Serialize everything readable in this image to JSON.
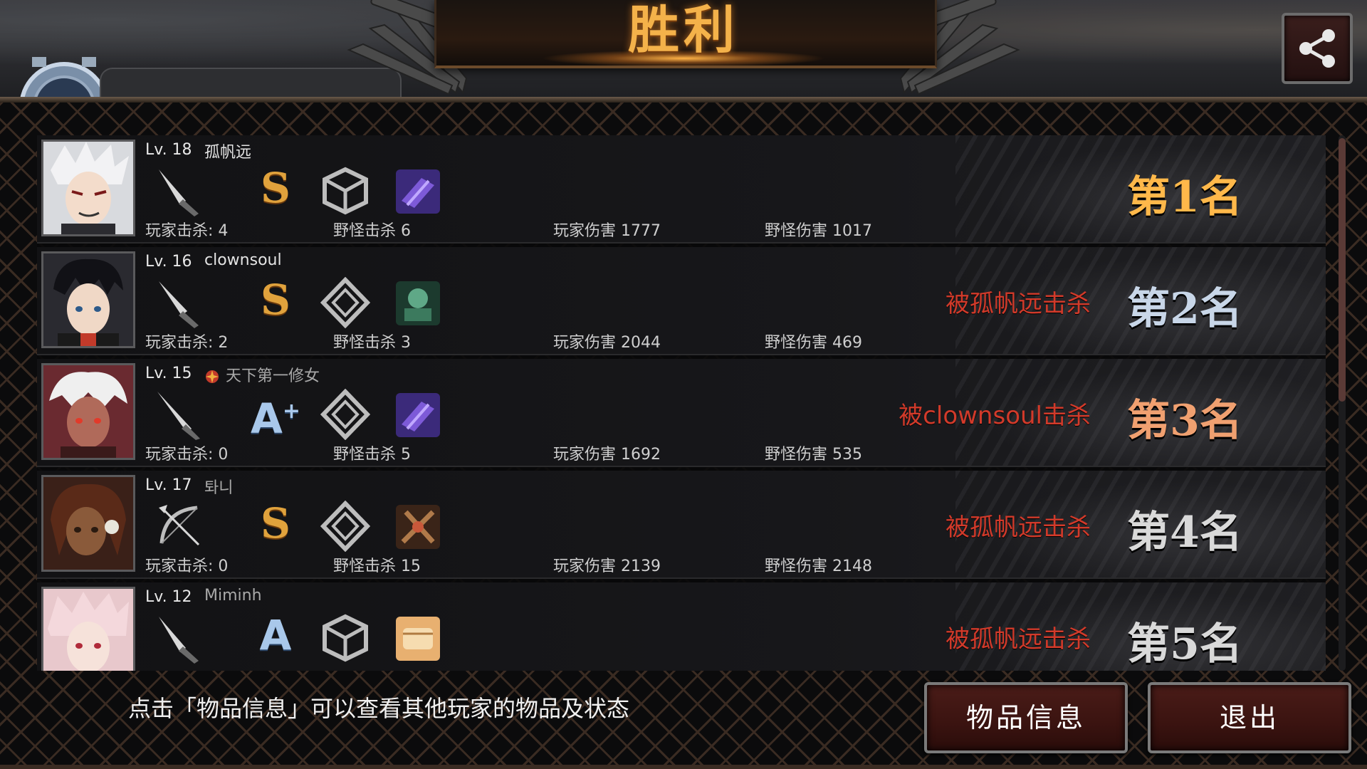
{
  "title": "胜利",
  "icons": {
    "share": "share-icon",
    "weapon_types": [
      "knife-icon",
      "dagger-icon",
      "sword-icon",
      "bow-icon",
      "knife-icon"
    ],
    "guild": "guild-emblem-icon"
  },
  "colors": {
    "title": "#f4b24a",
    "killed_by": "#d23a2a",
    "rank_1": "#ffb84a",
    "rank_2": "#c8d6e8",
    "rank_3": "#f0a070",
    "rank_4": "#d9d9d9",
    "rank_5": "#d9d9d9",
    "grade_s": "#e0a23c",
    "grade_a": "#a9c8ea"
  },
  "players": [
    {
      "level": "Lv. 18",
      "name": "孤帆远",
      "grade": "S",
      "player_kills": "玩家击杀: 4",
      "monster_kills": "野怪击杀 6",
      "player_damage": "玩家伤害 1777",
      "monster_damage": "野怪伤害 1017",
      "killed_by": "",
      "rank": "第1名"
    },
    {
      "level": "Lv. 16",
      "name": "clownsoul",
      "grade": "S",
      "player_kills": "玩家击杀: 2",
      "monster_kills": "野怪击杀 3",
      "player_damage": "玩家伤害 2044",
      "monster_damage": "野怪伤害 469",
      "killed_by": "被孤帆远击杀",
      "rank": "第2名"
    },
    {
      "level": "Lv. 15",
      "name": "天下第一修女",
      "grade": "A",
      "grade_sup": "+",
      "player_kills": "玩家击杀: 0",
      "monster_kills": "野怪击杀 5",
      "player_damage": "玩家伤害 1692",
      "monster_damage": "野怪伤害 535",
      "killed_by": "被clownsoul击杀",
      "rank": "第3名"
    },
    {
      "level": "Lv. 17",
      "name": "톼니",
      "grade": "S",
      "player_kills": "玩家击杀: 0",
      "monster_kills": "野怪击杀 15",
      "player_damage": "玩家伤害 2139",
      "monster_damage": "野怪伤害 2148",
      "killed_by": "被孤帆远击杀",
      "rank": "第4名"
    },
    {
      "level": "Lv. 12",
      "name": "Miminh",
      "grade": "A",
      "killed_by": "被孤帆远击杀",
      "rank": "第5名"
    }
  ],
  "hint": "点击「物品信息」可以查看其他玩家的物品及状态",
  "buttons": {
    "item_info": "物品信息",
    "exit": "退出"
  }
}
